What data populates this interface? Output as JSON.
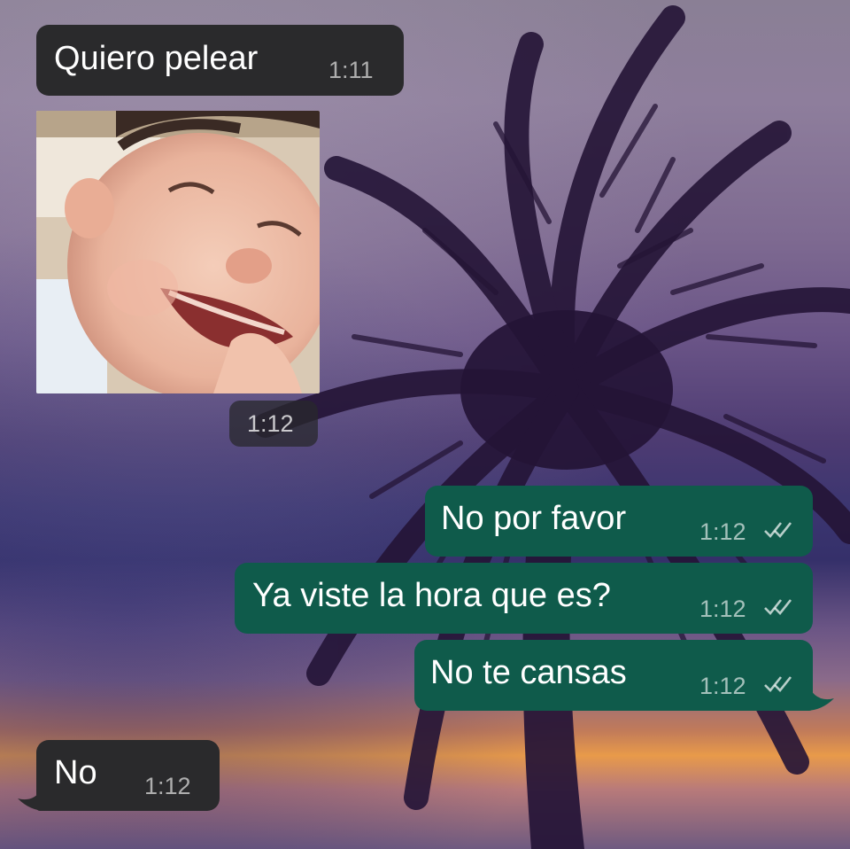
{
  "messages": [
    {
      "id": "m1",
      "direction": "incoming",
      "text": "Quiero pelear",
      "time": "1:11"
    },
    {
      "id": "m2",
      "direction": "incoming",
      "type": "photo",
      "photo_subject": "laughing baby",
      "time": "1:12"
    },
    {
      "id": "m3",
      "direction": "outgoing",
      "text": "No por favor",
      "time": "1:12",
      "status": "read-ticks-icon"
    },
    {
      "id": "m4",
      "direction": "outgoing",
      "text": "Ya viste la hora que es?",
      "time": "1:12",
      "status": "read-ticks-icon"
    },
    {
      "id": "m5",
      "direction": "outgoing",
      "text": "No te cansas",
      "time": "1:12",
      "status": "read-ticks-icon"
    },
    {
      "id": "m6",
      "direction": "incoming",
      "text": "No",
      "time": "1:12"
    }
  ],
  "colors": {
    "incoming_bubble": "#2a2a2c",
    "outgoing_bubble": "#0f5b4b",
    "wallpaper_top": "#8a7f95",
    "wallpaper_sunset": "#e89a4a"
  },
  "wallpaper": {
    "subject": "palm tree silhouette at sunset"
  }
}
